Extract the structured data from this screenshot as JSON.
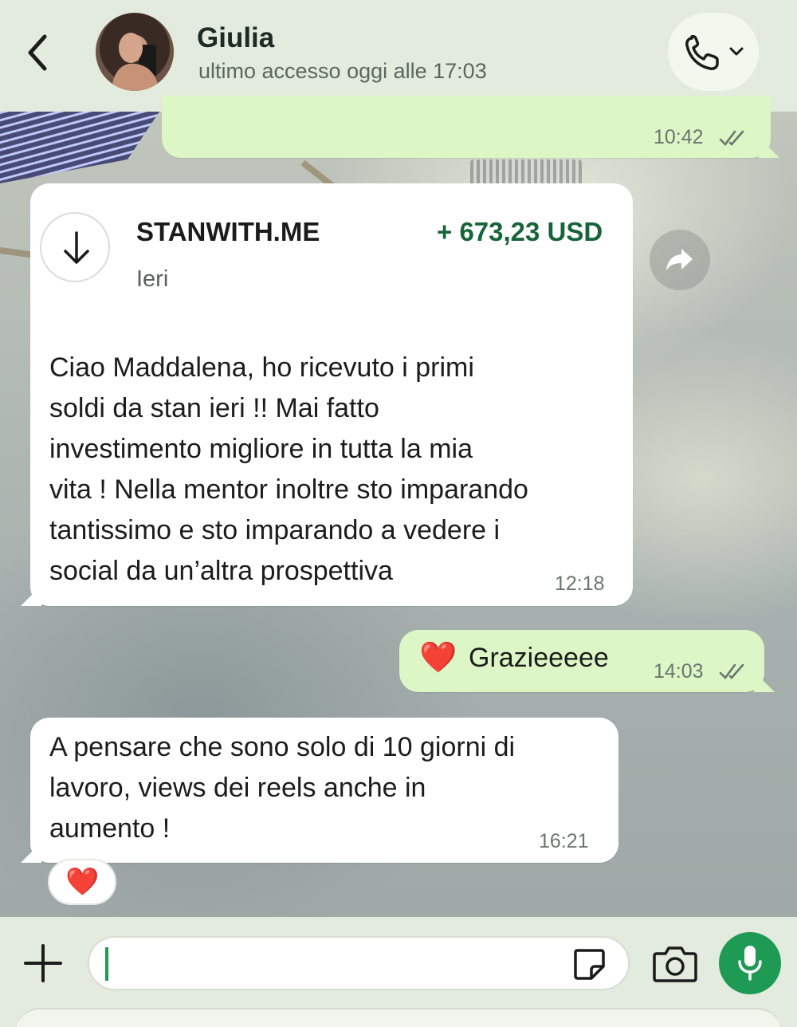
{
  "header": {
    "contact_name": "Giulia",
    "contact_status": "ultimo accesso oggi alle 17:03",
    "icons": [
      "chevron-left-icon",
      "phone-icon",
      "chevron-down-icon"
    ]
  },
  "messages": [
    {
      "direction": "outgoing",
      "time": "10:42",
      "status": "read"
    },
    {
      "direction": "incoming",
      "payment": {
        "merchant": "STANWITH.ME",
        "amount": "+ 673,23 USD",
        "date": "Ieri",
        "icon": "arrow-down-icon"
      },
      "text_lines": [
        "Ciao Maddalena, ho ricevuto i primi",
        "soldi da stan ieri !! Mai fatto",
        "investimento migliore in tutta la mia",
        "vita ! Nella mentor inoltre sto imparando",
        "tantissimo e sto imparando a vedere i",
        "social da un’altra prospettiva"
      ],
      "time": "12:18"
    },
    {
      "direction": "outgoing",
      "emoji": "❤️",
      "text": "Grazieeeee",
      "time": "14:03",
      "status": "read"
    },
    {
      "direction": "incoming",
      "text_lines": [
        "A pensare che sono solo di 10 giorni di",
        "lavoro, views dei reels anche in",
        "aumento !"
      ],
      "time": "16:21",
      "reaction": "❤️"
    }
  ],
  "input_bar": {
    "value": "",
    "icons": [
      "plus-icon",
      "sticker-icon",
      "camera-icon",
      "microphone-icon"
    ]
  },
  "colors": {
    "header_bg": "#e2ebdd",
    "outgoing_bubble": "#dcf7c5",
    "incoming_bubble": "#ffffff",
    "amount_green": "#17633a",
    "mic_green": "#1e9a55",
    "read_ticks": "#6a756f"
  }
}
